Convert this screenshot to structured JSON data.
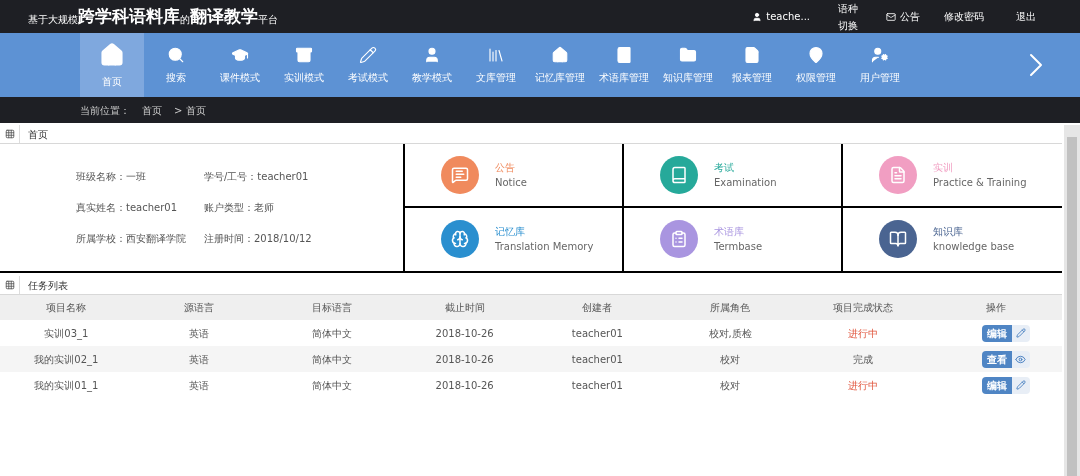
{
  "header": {
    "title_parts": [
      {
        "text": "基于大规模",
        "kind": "small"
      },
      {
        "text": "跨学科语料库",
        "kind": "large"
      },
      {
        "text": "的",
        "kind": "small"
      },
      {
        "text": "翻译教学",
        "kind": "large"
      },
      {
        "text": "平台",
        "kind": "small"
      }
    ],
    "user": "teache...",
    "links": [
      "语种切换",
      "公告",
      "修改密码",
      "退出"
    ]
  },
  "nav": {
    "items": [
      {
        "label": "首页",
        "selected": true
      },
      {
        "label": "搜索",
        "selected": false
      },
      {
        "label": "课件模式",
        "selected": false
      },
      {
        "label": "实训模式",
        "selected": false
      },
      {
        "label": "考试模式",
        "selected": false
      },
      {
        "label": "教学模式",
        "selected": false
      },
      {
        "label": "文库管理",
        "selected": false
      },
      {
        "label": "记忆库管理",
        "selected": false
      },
      {
        "label": "术语库管理",
        "selected": false
      },
      {
        "label": "知识库管理",
        "selected": false
      },
      {
        "label": "报表管理",
        "selected": false
      },
      {
        "label": "权限管理",
        "selected": false
      },
      {
        "label": "用户管理",
        "selected": false
      }
    ]
  },
  "breadcrumb": {
    "label": "当前位置：",
    "path": [
      "首页",
      "> 首页"
    ]
  },
  "home_panel": {
    "title": "首页",
    "info": [
      "班级名称：一班",
      "学号/工号：teacher01",
      "真实姓名：teacher01",
      "账户类型：老师",
      "所属学校：西安翻译学院",
      "注册时间：2018/10/12"
    ],
    "tiles": [
      {
        "title": "公告",
        "subtitle": "Notice",
        "color": "#f08a5d"
      },
      {
        "title": "考试",
        "subtitle": "Examination",
        "color": "#26a99a"
      },
      {
        "title": "实训",
        "subtitle": "Practice & Training",
        "color": "#f19ec2"
      },
      {
        "title": "记忆库",
        "subtitle": "Translation Memory",
        "color": "#2a8fcf"
      },
      {
        "title": "术语库",
        "subtitle": "Termbase",
        "color": "#a995e0"
      },
      {
        "title": "知识库",
        "subtitle": "knowledge base",
        "color": "#4a6491"
      }
    ]
  },
  "task_panel": {
    "title": "任务列表",
    "columns": [
      "项目名称",
      "源语言",
      "目标语言",
      "截止时间",
      "创建者",
      "所属角色",
      "项目完成状态",
      "操作"
    ],
    "rows": [
      {
        "cells": [
          "实训03_1",
          "英语",
          "简体中文",
          "2018-10-26",
          "teacher01",
          "校对,质检"
        ],
        "status": {
          "text": "进行中",
          "kind": "in_progress"
        },
        "action": {
          "label": "编辑",
          "kind": "edit"
        }
      },
      {
        "cells": [
          "我的实训02_1",
          "英语",
          "简体中文",
          "2018-10-26",
          "teacher01",
          "校对"
        ],
        "status": {
          "text": "完成",
          "kind": "done"
        },
        "action": {
          "label": "查看",
          "kind": "view"
        }
      },
      {
        "cells": [
          "我的实训01_1",
          "英语",
          "简体中文",
          "2018-10-26",
          "teacher01",
          "校对"
        ],
        "status": {
          "text": "进行中",
          "kind": "in_progress"
        },
        "action": {
          "label": "编辑",
          "kind": "edit"
        }
      }
    ]
  }
}
